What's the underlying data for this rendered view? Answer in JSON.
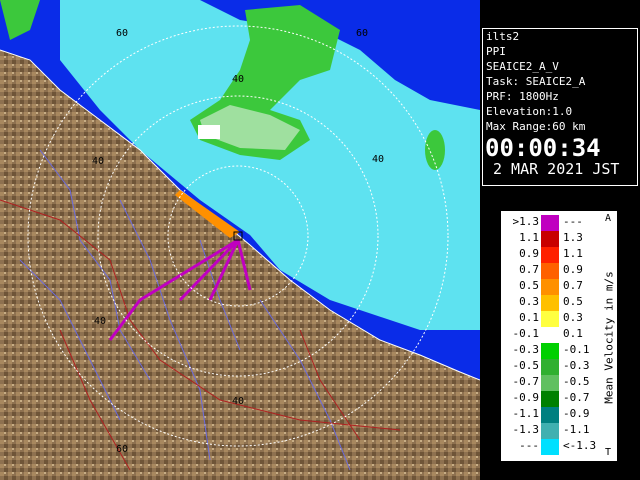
{
  "info": {
    "station": "ilts2",
    "scan_type": "PPI",
    "product": "SEAICE2_A_V",
    "task": "Task: SEAICE2_A",
    "prf": "PRF: 1800Hz",
    "elevation": "Elevation:1.0",
    "max_range": "Max Range:60 km",
    "time": "00:00:34",
    "date": "2 MAR 2021 JST"
  },
  "range_labels": [
    "60",
    "60",
    "40",
    "40",
    "40",
    "40",
    "40",
    "60"
  ],
  "legend": {
    "title": "Mean Velocity in m/s",
    "corner_top": "A",
    "corner_bottom": "T",
    "rows": [
      {
        "lo": ">1.3",
        "hi": "---",
        "color": "#c000c0"
      },
      {
        "lo": "1.1",
        "hi": "1.3",
        "color": "#c80000"
      },
      {
        "lo": "0.9",
        "hi": "1.1",
        "color": "#ff2000"
      },
      {
        "lo": "0.7",
        "hi": "0.9",
        "color": "#ff6000"
      },
      {
        "lo": "0.5",
        "hi": "0.7",
        "color": "#ff9000"
      },
      {
        "lo": "0.3",
        "hi": "0.5",
        "color": "#ffc000"
      },
      {
        "lo": "0.1",
        "hi": "0.3",
        "color": "#ffff40"
      },
      {
        "lo": "-0.1",
        "hi": "0.1",
        "color": "#ffffff"
      },
      {
        "lo": "-0.3",
        "hi": "-0.1",
        "color": "#00d000"
      },
      {
        "lo": "-0.5",
        "hi": "-0.3",
        "color": "#30b030"
      },
      {
        "lo": "-0.7",
        "hi": "-0.5",
        "color": "#60c060"
      },
      {
        "lo": "-0.9",
        "hi": "-0.7",
        "color": "#008000"
      },
      {
        "lo": "-1.1",
        "hi": "-0.9",
        "color": "#008080"
      },
      {
        "lo": "-1.3",
        "hi": "-1.1",
        "color": "#40b0b0"
      },
      {
        "lo": "---",
        "hi": "<-1.3",
        "color": "#00e0ff"
      }
    ]
  },
  "colors": {
    "sea": "#5ee2f0",
    "land": "#9b7c57",
    "range_rings": "#ffffff",
    "rivers": "#6b6bdc",
    "boundaries": "#b02020"
  }
}
